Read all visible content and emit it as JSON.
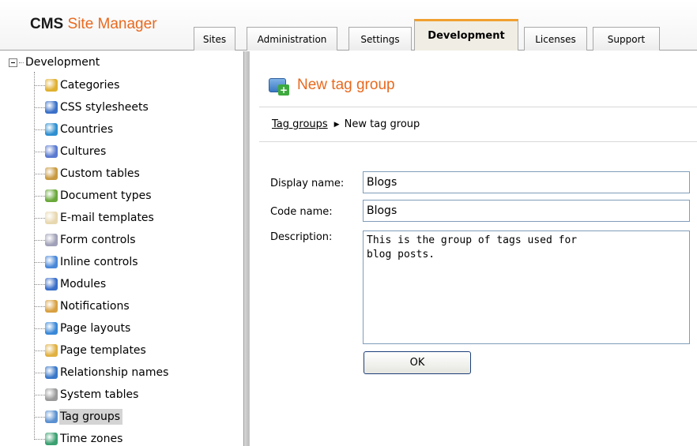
{
  "header": {
    "logo_cms": "CMS",
    "logo_site_manager": "Site Manager",
    "tabs": [
      {
        "label": "Sites"
      },
      {
        "label": "Administration"
      },
      {
        "label": "Settings"
      },
      {
        "label": "Development",
        "active": true
      },
      {
        "label": "Licenses"
      },
      {
        "label": "Support"
      }
    ]
  },
  "sidebar": {
    "root": "Development",
    "items": [
      {
        "label": "Categories",
        "icon": "categories-icon",
        "color": "#e0b030"
      },
      {
        "label": "CSS stylesheets",
        "icon": "css-stylesheets-icon",
        "color": "#3a70c8"
      },
      {
        "label": "Countries",
        "icon": "globe-icon",
        "color": "#2f8fd0"
      },
      {
        "label": "Cultures",
        "icon": "culture-globe-icon",
        "color": "#5a7ad0"
      },
      {
        "label": "Custom tables",
        "icon": "custom-tables-icon",
        "color": "#c89a40"
      },
      {
        "label": "Document types",
        "icon": "document-types-icon",
        "color": "#6aa83a"
      },
      {
        "label": "E-mail templates",
        "icon": "envelope-icon",
        "color": "#e8d8b0"
      },
      {
        "label": "Form controls",
        "icon": "form-controls-icon",
        "color": "#a0a0b8"
      },
      {
        "label": "Inline controls",
        "icon": "inline-controls-icon",
        "color": "#4a88d8"
      },
      {
        "label": "Modules",
        "icon": "modules-icon",
        "color": "#3a6ec8"
      },
      {
        "label": "Notifications",
        "icon": "notifications-icon",
        "color": "#d8a040"
      },
      {
        "label": "Page layouts",
        "icon": "page-layouts-icon",
        "color": "#3a88d8"
      },
      {
        "label": "Page templates",
        "icon": "page-templates-icon",
        "color": "#e0b040"
      },
      {
        "label": "Relationship names",
        "icon": "relationship-icon",
        "color": "#3a78c8"
      },
      {
        "label": "System tables",
        "icon": "system-tables-icon",
        "color": "#9a9a9a"
      },
      {
        "label": "Tag groups",
        "icon": "tag-groups-icon",
        "color": "#5a90d0",
        "selected": true
      },
      {
        "label": "Time zones",
        "icon": "time-zones-icon",
        "color": "#3aa070"
      }
    ]
  },
  "main": {
    "title": "New tag group",
    "breadcrumb": {
      "link": "Tag groups",
      "current": "New tag group"
    },
    "form": {
      "display_name_label": "Display name:",
      "display_name_value": "Blogs",
      "code_name_label": "Code name:",
      "code_name_value": "Blogs",
      "description_label": "Description:",
      "description_value": "This is the group of tags used for\nblog posts.",
      "ok_label": "OK"
    }
  }
}
